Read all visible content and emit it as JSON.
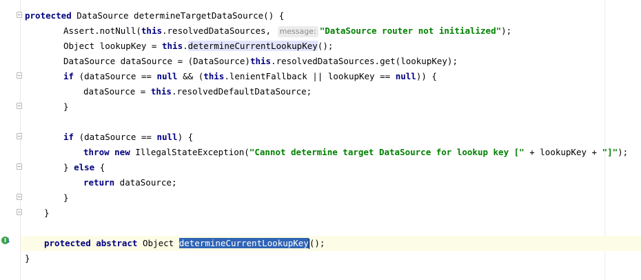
{
  "editor": {
    "lines": [
      [
        {
          "t": "kw",
          "v": "protected"
        },
        {
          "t": "plain",
          "v": " DataSource determineTargetDataSource() {"
        }
      ],
      [
        {
          "t": "plain",
          "v": "Assert.notNull("
        },
        {
          "t": "kw",
          "v": "this"
        },
        {
          "t": "plain",
          "v": ".resolvedDataSources, "
        },
        {
          "t": "hint",
          "v": "message:"
        },
        {
          "t": "str",
          "v": "\"DataSource router not initialized\""
        },
        {
          "t": "plain",
          "v": ");"
        }
      ],
      [
        {
          "t": "plain",
          "v": "Object lookupKey = "
        },
        {
          "t": "kw",
          "v": "this"
        },
        {
          "t": "plain",
          "v": "."
        },
        {
          "t": "usage",
          "v": "determineCurrentLookupKey"
        },
        {
          "t": "plain",
          "v": "();"
        }
      ],
      [
        {
          "t": "plain",
          "v": "DataSource dataSource = (DataSource)"
        },
        {
          "t": "kw",
          "v": "this"
        },
        {
          "t": "plain",
          "v": ".resolvedDataSources.get(lookupKey);"
        }
      ],
      [
        {
          "t": "kw",
          "v": "if"
        },
        {
          "t": "plain",
          "v": " (dataSource == "
        },
        {
          "t": "kw",
          "v": "null"
        },
        {
          "t": "plain",
          "v": " && ("
        },
        {
          "t": "kw",
          "v": "this"
        },
        {
          "t": "plain",
          "v": ".lenientFallback || lookupKey == "
        },
        {
          "t": "kw",
          "v": "null"
        },
        {
          "t": "plain",
          "v": ")) {"
        }
      ],
      [
        {
          "t": "plain",
          "v": "dataSource = "
        },
        {
          "t": "kw",
          "v": "this"
        },
        {
          "t": "plain",
          "v": ".resolvedDefaultDataSource;"
        }
      ],
      [
        {
          "t": "plain",
          "v": "}"
        }
      ],
      [],
      [
        {
          "t": "kw",
          "v": "if"
        },
        {
          "t": "plain",
          "v": " (dataSource == "
        },
        {
          "t": "kw",
          "v": "null"
        },
        {
          "t": "plain",
          "v": ") {"
        }
      ],
      [
        {
          "t": "kw",
          "v": "throw new"
        },
        {
          "t": "plain",
          "v": " IllegalStateException("
        },
        {
          "t": "str",
          "v": "\"Cannot determine target DataSource for lookup key [\""
        },
        {
          "t": "plain",
          "v": " + lookupKey + "
        },
        {
          "t": "str",
          "v": "\"]\""
        },
        {
          "t": "plain",
          "v": ");"
        }
      ],
      [
        {
          "t": "plain",
          "v": "} "
        },
        {
          "t": "kw",
          "v": "else"
        },
        {
          "t": "plain",
          "v": " {"
        }
      ],
      [
        {
          "t": "kw",
          "v": "return"
        },
        {
          "t": "plain",
          "v": " dataSource;"
        }
      ],
      [
        {
          "t": "plain",
          "v": "}"
        }
      ],
      [
        {
          "t": "plain",
          "v": "}"
        }
      ],
      [],
      [
        {
          "t": "kw",
          "v": "protected abstract"
        },
        {
          "t": "plain",
          "v": " Object "
        },
        {
          "t": "sel",
          "v": "determineCurrentLookupKey"
        },
        {
          "t": "caret",
          "v": ""
        },
        {
          "t": "plain",
          "v": "();"
        }
      ],
      [
        {
          "t": "plain",
          "v": "}"
        }
      ]
    ]
  },
  "gutter": {
    "marker_icon": "implements-method-icon",
    "marker_label": "I",
    "arrow_icon": "arrow-down-icon",
    "arrow_glyph": "↓"
  },
  "colors": {
    "keyword": "#000080",
    "string": "#008000",
    "selection": "#2f64b6",
    "current_line": "#fdfce6",
    "usage_highlight": "#e3e4fb"
  }
}
